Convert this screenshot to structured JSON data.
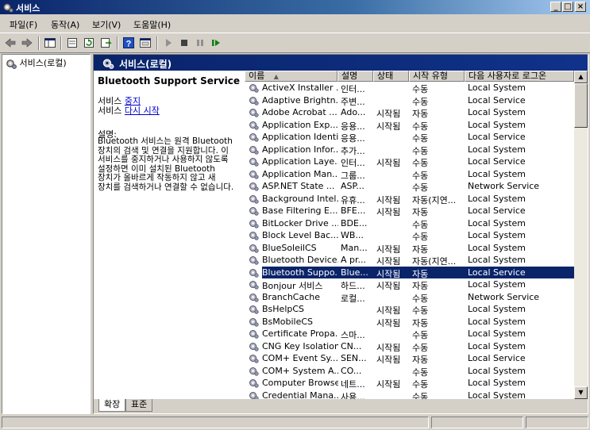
{
  "window": {
    "title": "서비스",
    "btn_min": "_",
    "btn_max": "□",
    "btn_close": "×"
  },
  "menu": [
    "파일(F)",
    "동작(A)",
    "보기(V)",
    "도움말(H)"
  ],
  "toolbar_icons": [
    "back-icon",
    "forward-icon",
    "console-tree-icon",
    "properties-icon",
    "refresh-icon",
    "export-icon",
    "help-icon",
    "mmc-icon",
    "start-service-icon",
    "stop-service-icon",
    "pause-service-icon",
    "restart-service-icon"
  ],
  "tree": {
    "root": "서비스(로컬)"
  },
  "panel": {
    "header": "서비스(로컬)"
  },
  "detail": {
    "title": "Bluetooth Support Service",
    "stop_prefix": "서비스 ",
    "stop_link": "중지",
    "restart_prefix": "서비스 ",
    "restart_link": "다시 시작",
    "desc_label": "설명:",
    "description": "Bluetooth 서비스는 원격 Bluetooth 장치의 검색 및 연결을 지원합니다. 이 서비스를 중지하거나 사용하지 않도록 설정하면 이미 설치된 Bluetooth 장치가 올바르게 작동하지 않고 새 장치를 검색하거나 연결할 수 없습니다."
  },
  "columns": {
    "name": "이름",
    "sort_indicator": "▲",
    "desc": "설명",
    "status": "상태",
    "startup": "시작 유형",
    "logon": "다음 사용자로 로그온"
  },
  "rows": [
    {
      "name": "ActiveX Installer ...",
      "desc": "인터...",
      "status": "",
      "startup": "수동",
      "logon": "Local System"
    },
    {
      "name": "Adaptive Brightn...",
      "desc": "주변...",
      "status": "",
      "startup": "수동",
      "logon": "Local Service"
    },
    {
      "name": "Adobe Acrobat ...",
      "desc": "Ado...",
      "status": "시작됨",
      "startup": "자동",
      "logon": "Local System"
    },
    {
      "name": "Application Exp...",
      "desc": "응용...",
      "status": "시작됨",
      "startup": "수동",
      "logon": "Local System"
    },
    {
      "name": "Application Identity",
      "desc": "응용...",
      "status": "",
      "startup": "수동",
      "logon": "Local Service"
    },
    {
      "name": "Application Infor...",
      "desc": "추가...",
      "status": "",
      "startup": "수동",
      "logon": "Local System"
    },
    {
      "name": "Application Laye...",
      "desc": "인터...",
      "status": "시작됨",
      "startup": "수동",
      "logon": "Local Service"
    },
    {
      "name": "Application Man...",
      "desc": "그룹...",
      "status": "",
      "startup": "수동",
      "logon": "Local System"
    },
    {
      "name": "ASP.NET State ...",
      "desc": "ASP...",
      "status": "",
      "startup": "수동",
      "logon": "Network Service"
    },
    {
      "name": "Background Intel...",
      "desc": "유휴...",
      "status": "시작됨",
      "startup": "자동(지연...",
      "logon": "Local System"
    },
    {
      "name": "Base Filtering E...",
      "desc": "BFE...",
      "status": "시작됨",
      "startup": "자동",
      "logon": "Local Service"
    },
    {
      "name": "BitLocker Drive ...",
      "desc": "BDE...",
      "status": "",
      "startup": "수동",
      "logon": "Local System"
    },
    {
      "name": "Block Level Bac...",
      "desc": "WB...",
      "status": "",
      "startup": "수동",
      "logon": "Local System"
    },
    {
      "name": "BlueSoleilCS",
      "desc": "Man...",
      "status": "시작됨",
      "startup": "자동",
      "logon": "Local System"
    },
    {
      "name": "Bluetooth Device...",
      "desc": "A pr...",
      "status": "시작됨",
      "startup": "자동(지연...",
      "logon": "Local System"
    },
    {
      "name": "Bluetooth Suppo...",
      "desc": "Blue...",
      "status": "시작됨",
      "startup": "자동",
      "logon": "Local Service",
      "selected": true
    },
    {
      "name": "Bonjour 서비스",
      "desc": "하드...",
      "status": "시작됨",
      "startup": "자동",
      "logon": "Local System"
    },
    {
      "name": "BranchCache",
      "desc": "로컬...",
      "status": "",
      "startup": "수동",
      "logon": "Network Service"
    },
    {
      "name": "BsHelpCS",
      "desc": "",
      "status": "시작됨",
      "startup": "수동",
      "logon": "Local System"
    },
    {
      "name": "BsMobileCS",
      "desc": "",
      "status": "시작됨",
      "startup": "자동",
      "logon": "Local System"
    },
    {
      "name": "Certificate Propa...",
      "desc": "스마...",
      "status": "",
      "startup": "수동",
      "logon": "Local System"
    },
    {
      "name": "CNG Key Isolation",
      "desc": "CN...",
      "status": "시작됨",
      "startup": "수동",
      "logon": "Local System"
    },
    {
      "name": "COM+ Event Sy...",
      "desc": "SEN...",
      "status": "시작됨",
      "startup": "자동",
      "logon": "Local Service"
    },
    {
      "name": "COM+ System A...",
      "desc": "CO...",
      "status": "",
      "startup": "수동",
      "logon": "Local System"
    },
    {
      "name": "Computer Browser",
      "desc": "네트...",
      "status": "시작됨",
      "startup": "수동",
      "logon": "Local System"
    },
    {
      "name": "Credential Mana...",
      "desc": "사용...",
      "status": "",
      "startup": "수동",
      "logon": "Local System"
    }
  ],
  "scroll": {
    "up": "▲",
    "down": "▼"
  },
  "tabs": [
    "확장",
    "표준"
  ],
  "colors": {
    "selection": "#0a246a",
    "header": "#0a246a",
    "link": "#0000cc"
  }
}
